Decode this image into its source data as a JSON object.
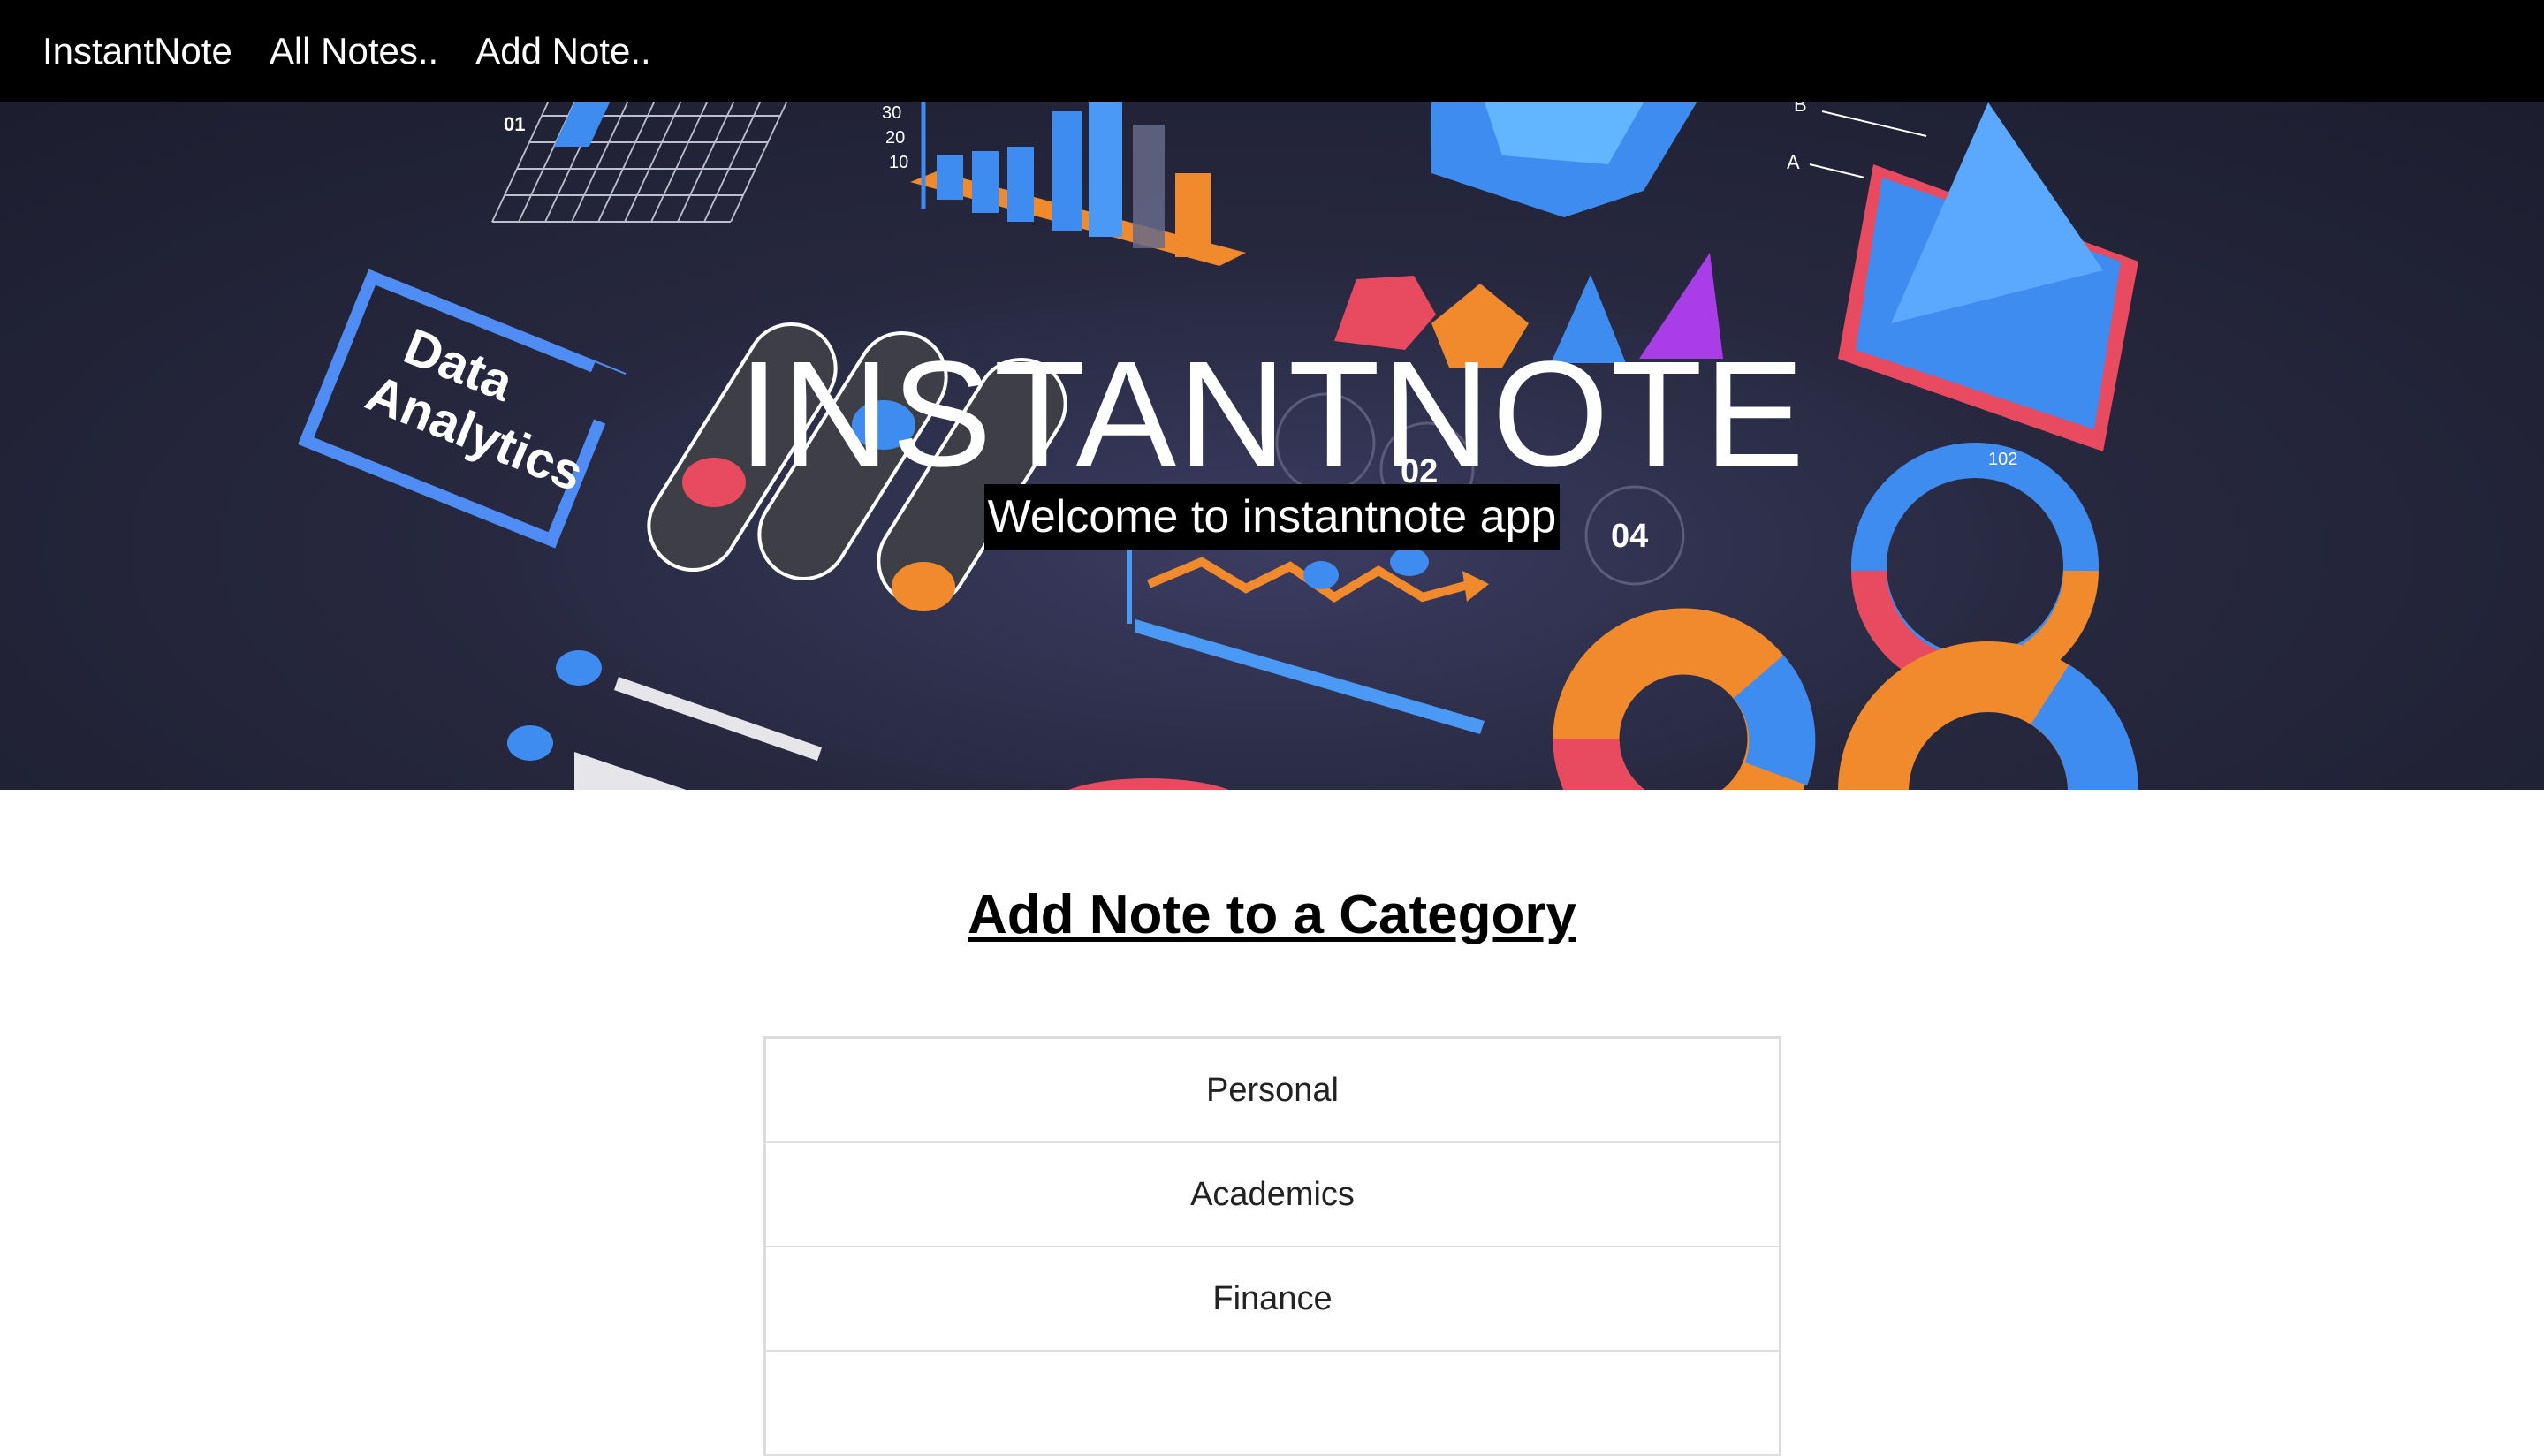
{
  "nav": {
    "brand": "InstantNote",
    "all_notes": "All Notes..",
    "add_note": "Add Note.."
  },
  "hero": {
    "title": "INSTANTNOTE",
    "subtitle": "Welcome to instantnote app",
    "art": {
      "badge_line1": "Data",
      "badge_line2": "Analytics",
      "num_01": "01",
      "num_02": "02",
      "num_04": "04",
      "axis_30": "30",
      "axis_20": "20",
      "axis_10": "10",
      "label_a": "A",
      "label_b": "B",
      "ring_label": "102"
    }
  },
  "main": {
    "heading": "Add Note to a Category",
    "categories": [
      "Personal",
      "Academics",
      "Finance",
      ""
    ]
  },
  "colors": {
    "navbar_bg": "#000000",
    "hero_bg": "#27283f",
    "accent_blue": "#3f8cf0",
    "accent_orange": "#f08a2c",
    "accent_red": "#e84a5f",
    "accent_purple": "#a93ee8"
  }
}
